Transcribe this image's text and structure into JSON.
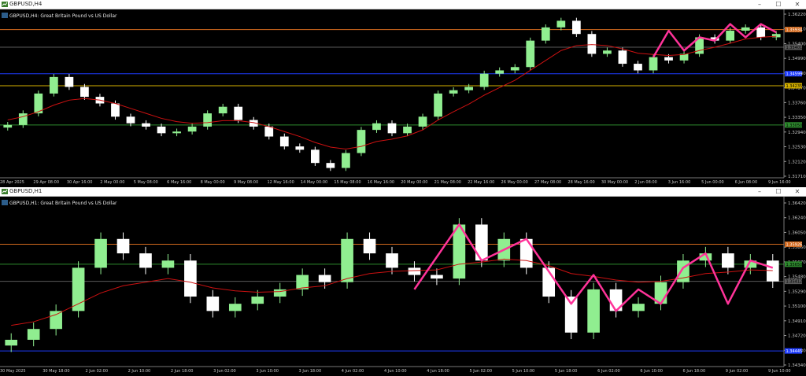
{
  "colors": {
    "background": "#000000",
    "bull": "#90ee90",
    "bear": "#ffffff",
    "ma": "#cc1111",
    "zigzag": "#ff3399",
    "grid_text": "#c8c8c8",
    "orange_line": "#d2691e",
    "green_line": "#2e8b2e",
    "blue_line": "#1e3cff",
    "yellow_line": "#d4b000"
  },
  "panels": [
    {
      "window_title": "GBPUSD,H4",
      "info_line": "GBPUSD,H4: Great Britain Pound vs US Dollar",
      "controls": [
        "–",
        "☐",
        "✕"
      ],
      "price_labels": [
        "1.36220",
        "1.35810",
        "1.35400",
        "1.34990",
        "1.34580",
        "1.34170",
        "1.33760",
        "1.33350",
        "1.32940",
        "1.32530",
        "1.32120",
        "1.31710"
      ],
      "time_labels": [
        "28 Apr 2025",
        "29 Apr 08:00",
        "30 Apr 16:00",
        "2 May 00:00",
        "5 May 08:00",
        "6 May 16:00",
        "8 May 00:00",
        "9 May 08:00",
        "12 May 16:00",
        "14 May 00:00",
        "15 May 08:00",
        "16 May 16:00",
        "20 May 00:00",
        "21 May 08:00",
        "22 May 16:00",
        "26 May 00:00",
        "27 May 08:00",
        "28 May 16:00",
        "30 May 00:00",
        "2 Jun 08:00",
        "3 Jun 16:00",
        "5 Jun 00:00",
        "6 Jun 08:00",
        "9 Jun 16:00"
      ],
      "level_tags": [
        {
          "text": "1.35934",
          "color": "orange"
        },
        {
          "text": "1.35401",
          "color": "gray"
        },
        {
          "text": "1.34599",
          "color": "blue"
        },
        {
          "text": "1.34235",
          "color": "yellow"
        },
        {
          "text": "1.33050",
          "color": "green"
        }
      ]
    },
    {
      "window_title": "GBPUSD,H1",
      "info_line": "GBPUSD,H1: Great Britain Pound vs US Dollar",
      "controls": [
        "–",
        "☐",
        "✕"
      ],
      "price_labels": [
        "1.36420",
        "1.36240",
        "1.36050",
        "1.35860",
        "1.35670",
        "1.35480",
        "1.35290",
        "1.35100",
        "1.34910",
        "1.34720",
        "1.34530",
        "1.34340"
      ],
      "time_labels": [
        "30 May 2025",
        "30 May 18:00",
        "2 Jun 02:00",
        "2 Jun 10:00",
        "2 Jun 18:00",
        "3 Jun 02:00",
        "3 Jun 10:00",
        "3 Jun 18:00",
        "4 Jun 02:00",
        "4 Jun 10:00",
        "4 Jun 18:00",
        "5 Jun 02:00",
        "5 Jun 10:00",
        "5 Jun 18:00",
        "6 Jun 02:00",
        "6 Jun 10:00",
        "6 Jun 18:00",
        "9 Jun 02:00",
        "9 Jun 10:00"
      ],
      "level_tags": [
        {
          "text": "1.35926",
          "color": "orange"
        },
        {
          "text": "1.35650",
          "color": "green"
        },
        {
          "text": "1.35412",
          "color": "gray"
        },
        {
          "text": "1.34445",
          "color": "blue"
        }
      ]
    }
  ],
  "chart_data": [
    {
      "type": "candlestick",
      "title": "GBPUSD,H4: Great Britain Pound vs US Dollar",
      "symbol": "GBPUSD",
      "timeframe": "H4",
      "ylim": [
        1.315,
        1.364
      ],
      "x_range": [
        "28 Apr 2025",
        "9 Jun 16:00"
      ],
      "horizontal_lines": [
        1.35934,
        1.35401,
        1.34599,
        1.34235,
        1.3305
      ],
      "series": [
        {
          "name": "Close",
          "values": [
            1.3305,
            1.334,
            1.34,
            1.345,
            1.342,
            1.339,
            1.337,
            1.333,
            1.331,
            1.33,
            1.328,
            1.3285,
            1.33,
            1.334,
            1.336,
            1.332,
            1.33,
            1.327,
            1.324,
            1.323,
            1.319,
            1.3175,
            1.322,
            1.329,
            1.331,
            1.328,
            1.33,
            1.333,
            1.34,
            1.341,
            1.342,
            1.346,
            1.347,
            1.348,
            1.356,
            1.36,
            1.362,
            1.358,
            1.352,
            1.353,
            1.349,
            1.347,
            1.351,
            1.35,
            1.352,
            1.357,
            1.356,
            1.359,
            1.36,
            1.357,
            1.358
          ]
        },
        {
          "name": "MA",
          "values": [
            1.332,
            1.333,
            1.3345,
            1.3365,
            1.338,
            1.3385,
            1.338,
            1.337,
            1.3355,
            1.334,
            1.3325,
            1.3315,
            1.331,
            1.3312,
            1.3318,
            1.3318,
            1.3312,
            1.33,
            1.3285,
            1.327,
            1.3252,
            1.3238,
            1.3232,
            1.324,
            1.3255,
            1.3262,
            1.3272,
            1.329,
            1.332,
            1.3345,
            1.3368,
            1.3395,
            1.3418,
            1.344,
            1.347,
            1.35,
            1.353,
            1.3545,
            1.3548,
            1.3545,
            1.3535,
            1.3522,
            1.3518,
            1.3515,
            1.3518,
            1.353,
            1.354,
            1.3552,
            1.3565,
            1.357,
            1.3573
          ]
        },
        {
          "name": "ZigZag",
          "x_index": [
            42,
            43,
            44,
            45,
            46,
            47,
            48,
            49,
            50
          ],
          "values": [
            1.351,
            1.359,
            1.353,
            1.357,
            1.356,
            1.361,
            1.357,
            1.361,
            1.3585
          ]
        }
      ]
    },
    {
      "type": "candlestick",
      "title": "GBPUSD,H1: Great Britain Pound vs US Dollar",
      "symbol": "GBPUSD",
      "timeframe": "H1",
      "ylim": [
        1.3425,
        1.365
      ],
      "x_range": [
        "30 May 2025",
        "9 Jun 10:00"
      ],
      "horizontal_lines": [
        1.35926,
        1.3565,
        1.35412,
        1.34445
      ],
      "series": [
        {
          "name": "Close",
          "values": [
            1.346,
            1.3475,
            1.35,
            1.356,
            1.36,
            1.358,
            1.356,
            1.357,
            1.352,
            1.35,
            1.351,
            1.352,
            1.353,
            1.355,
            1.354,
            1.36,
            1.358,
            1.356,
            1.355,
            1.3545,
            1.362,
            1.357,
            1.36,
            1.356,
            1.352,
            1.347,
            1.353,
            1.35,
            1.351,
            1.354,
            1.357,
            1.358,
            1.356,
            1.357,
            1.3541
          ]
        },
        {
          "name": "MA",
          "values": [
            1.348,
            1.3485,
            1.3495,
            1.351,
            1.3525,
            1.3535,
            1.354,
            1.3545,
            1.354,
            1.3532,
            1.3528,
            1.3526,
            1.3527,
            1.3532,
            1.3535,
            1.3545,
            1.3552,
            1.3555,
            1.3556,
            1.3557,
            1.3565,
            1.3568,
            1.3572,
            1.357,
            1.3563,
            1.3552,
            1.3548,
            1.3543,
            1.354,
            1.3541,
            1.3546,
            1.3552,
            1.3554,
            1.3557,
            1.3556
          ]
        },
        {
          "name": "ZigZag",
          "x_index": [
            18,
            20,
            21,
            23,
            25,
            26,
            27,
            28,
            29,
            30,
            31,
            32,
            33,
            34
          ],
          "values": [
            1.353,
            1.362,
            1.357,
            1.36,
            1.351,
            1.355,
            1.35,
            1.353,
            1.351,
            1.356,
            1.358,
            1.351,
            1.357,
            1.356
          ]
        }
      ]
    }
  ]
}
